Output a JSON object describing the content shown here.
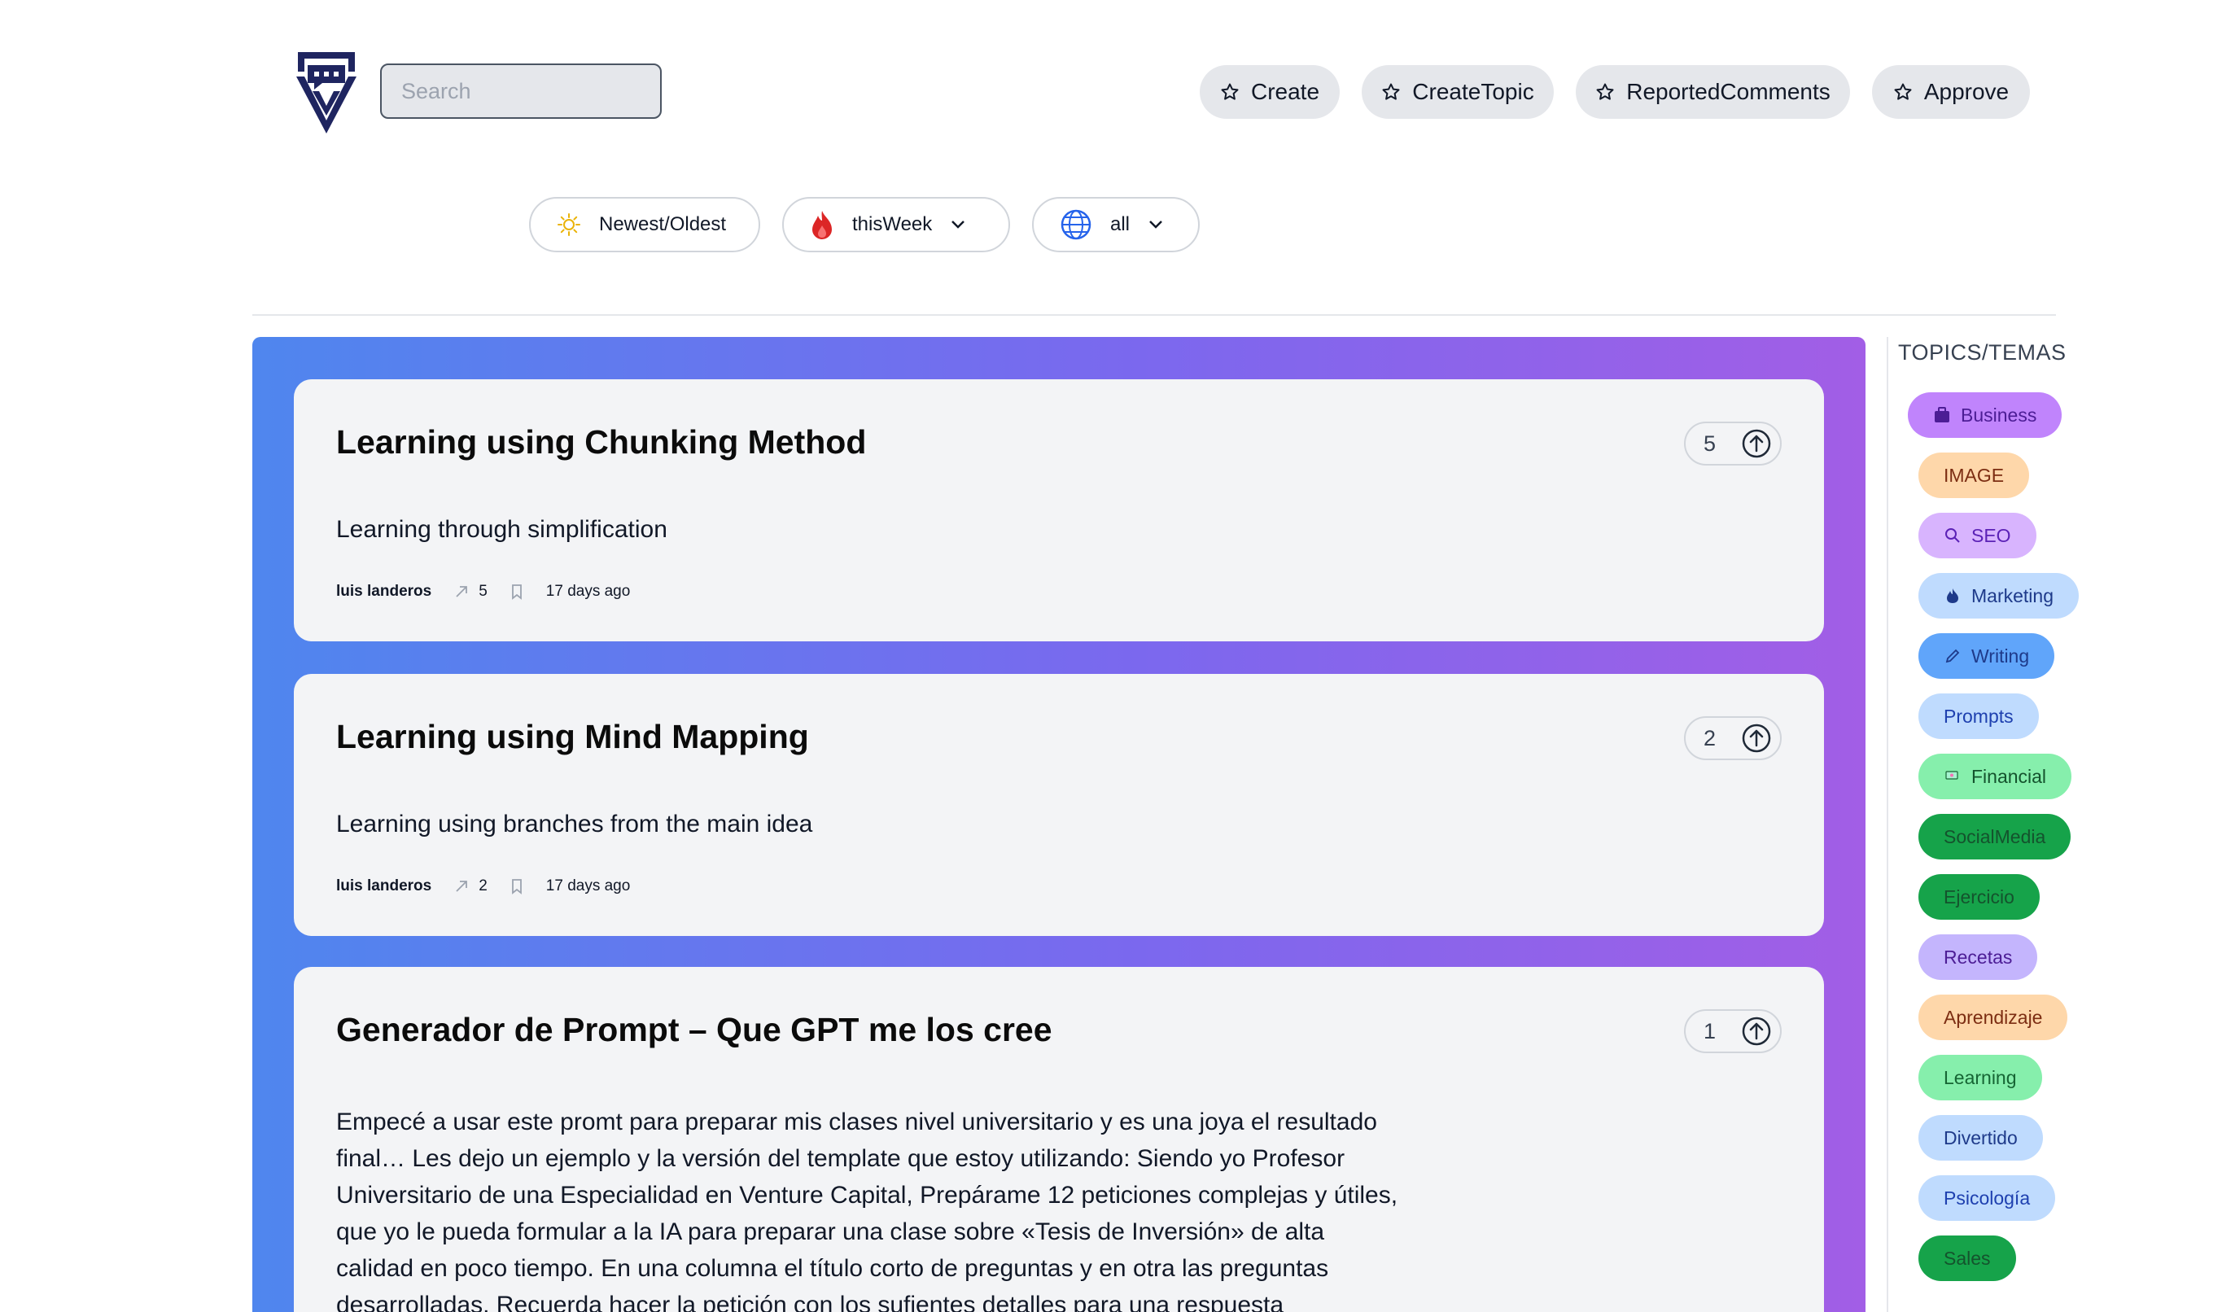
{
  "header": {
    "search_placeholder": "Search",
    "buttons": [
      "Create",
      "CreateTopic",
      "ReportedComments",
      "Approve"
    ]
  },
  "filters": {
    "sort": "Newest/Oldest",
    "period": "thisWeek",
    "scope": "all"
  },
  "posts": [
    {
      "title": "Learning using Chunking Method",
      "body": "Learning through simplification",
      "author": "luis landeros",
      "shares": "5",
      "time": "17 days ago",
      "votes": "5"
    },
    {
      "title": "Learning using Mind Mapping",
      "body": "Learning using branches from the main idea",
      "author": "luis landeros",
      "shares": "2",
      "time": "17 days ago",
      "votes": "2"
    },
    {
      "title": "Generador de Prompt – Que GPT me los cree",
      "body_lines": [
        "Empecé a usar este promt para preparar mis clases nivel universitario y es una joya el resultado",
        "final… Les dejo un ejemplo y la versión del template que estoy utilizando: Siendo yo Profesor",
        "Universitario de una Especialidad en Venture Capital, Prepárame 12 peticiones complejas y útiles,",
        "que yo le pueda formular a la IA para preparar una clase sobre «Tesis de Inversión» de alta",
        "calidad en poco tiempo. En una columna el título corto de preguntas y en otra las preguntas",
        "desarrolladas. Recuerda hacer la petición con los sufientes detalles para una respuesta"
      ],
      "votes": "1"
    }
  ],
  "sidebar": {
    "title": "TOPICS/TEMAS",
    "topics": [
      {
        "label": "Business",
        "bg": "#c084fc",
        "fg": "#4c1d95",
        "icon": "briefcase-icon"
      },
      {
        "label": "IMAGE",
        "bg": "#fed7aa",
        "fg": "#7c2d12",
        "icon": ""
      },
      {
        "label": "SEO",
        "bg": "#d8b4fe",
        "fg": "#5b21b6",
        "icon": "search-icon"
      },
      {
        "label": "Marketing",
        "bg": "#bfdbfe",
        "fg": "#1e3a8a",
        "icon": "flame-icon"
      },
      {
        "label": "Writing",
        "bg": "#60a5fa",
        "fg": "#1e3a8a",
        "icon": "pencil-icon"
      },
      {
        "label": "Prompts",
        "bg": "#bfdbfe",
        "fg": "#1e40af",
        "icon": ""
      },
      {
        "label": "Financial",
        "bg": "#86efac",
        "fg": "#14532d",
        "icon": "money-icon"
      },
      {
        "label": "SocialMedia",
        "bg": "#16a34a",
        "fg": "#14532d",
        "icon": ""
      },
      {
        "label": "Ejercicio",
        "bg": "#16a34a",
        "fg": "#14532d",
        "icon": ""
      },
      {
        "label": "Recetas",
        "bg": "#c4b5fd",
        "fg": "#4c1d95",
        "icon": ""
      },
      {
        "label": "Aprendizaje",
        "bg": "#fed7aa",
        "fg": "#7c2d12",
        "icon": ""
      },
      {
        "label": "Learning",
        "bg": "#86efac",
        "fg": "#166534",
        "icon": ""
      },
      {
        "label": "Divertido",
        "bg": "#bfdbfe",
        "fg": "#1e3a8a",
        "icon": ""
      },
      {
        "label": "Psicología",
        "bg": "#bfdbfe",
        "fg": "#1e40af",
        "icon": ""
      },
      {
        "label": "Sales",
        "bg": "#16a34a",
        "fg": "#14532d",
        "icon": ""
      }
    ]
  }
}
